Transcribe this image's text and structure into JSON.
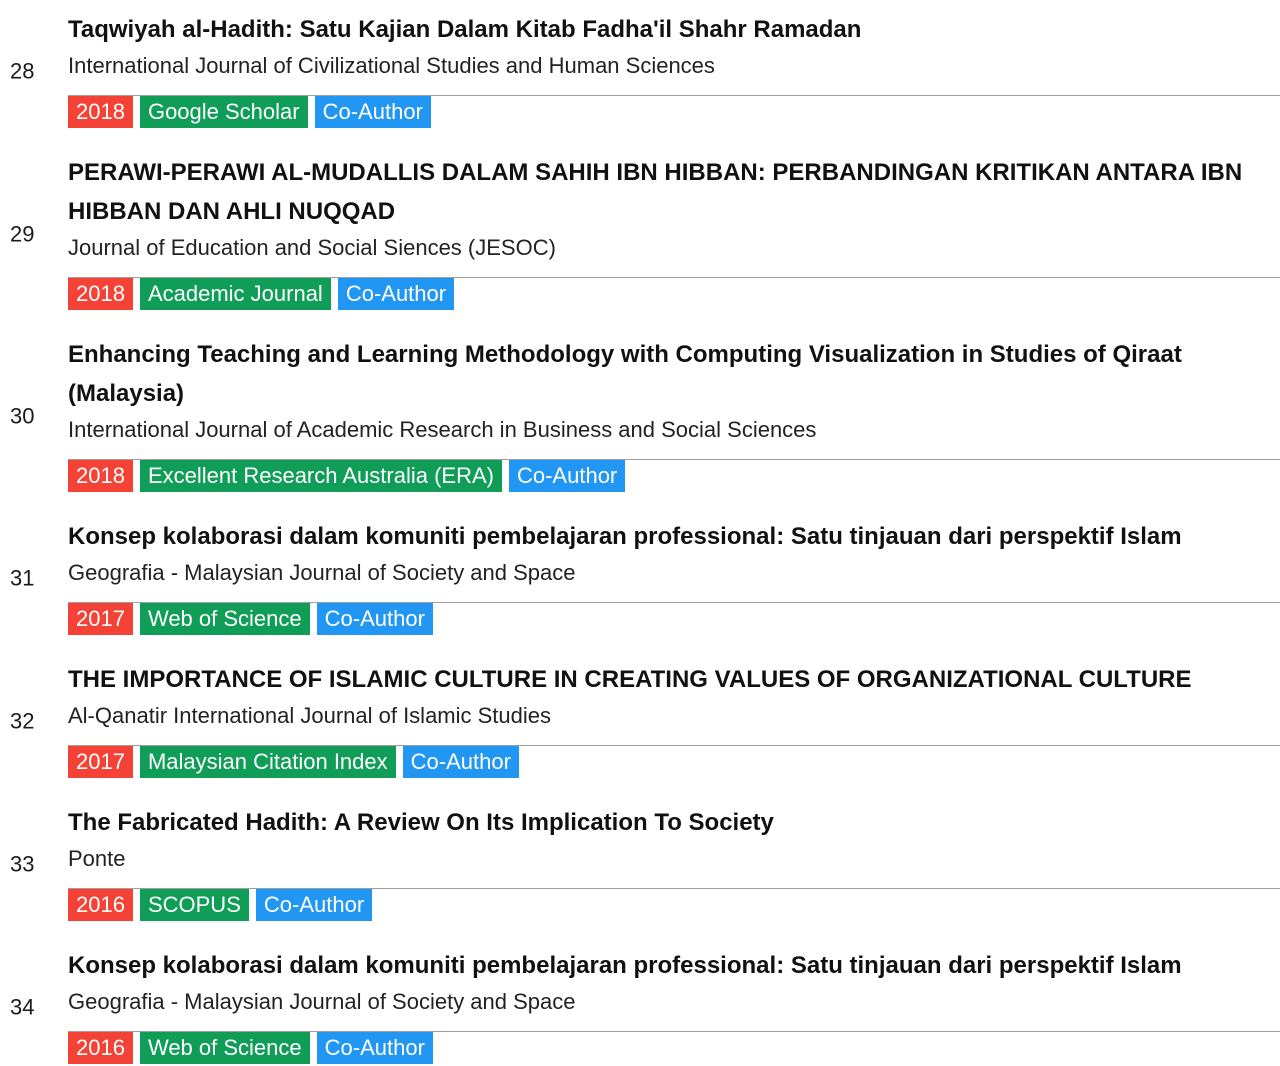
{
  "publications": [
    {
      "number": "28",
      "title": "Taqwiyah al-Hadith: Satu Kajian Dalam Kitab Fadha'il Shahr Ramadan",
      "journal": "International Journal of Civilizational Studies and Human Sciences",
      "year": "2018",
      "index": "Google Scholar",
      "role": "Co-Author"
    },
    {
      "number": "29",
      "title": "PERAWI-PERAWI AL-MUDALLIS DALAM SAHIH IBN HIBBAN: PERBANDINGAN KRITIKAN ANTARA IBN HIBBAN DAN AHLI NUQQAD",
      "journal": "Journal of Education and Social Siences (JESOC)",
      "year": "2018",
      "index": "Academic Journal",
      "role": "Co-Author"
    },
    {
      "number": "30",
      "title": "Enhancing Teaching and Learning Methodology with Computing Visualization in Studies of Qiraat (Malaysia)",
      "journal": "International Journal of Academic Research in Business and Social Sciences",
      "year": "2018",
      "index": "Excellent Research Australia (ERA)",
      "role": "Co-Author"
    },
    {
      "number": "31",
      "title": "Konsep kolaborasi dalam komuniti pembelajaran professional: Satu tinjauan dari perspektif Islam",
      "journal": "Geografia - Malaysian Journal of Society and Space",
      "year": "2017",
      "index": "Web of Science",
      "role": "Co-Author"
    },
    {
      "number": "32",
      "title": "THE IMPORTANCE OF ISLAMIC CULTURE IN CREATING VALUES OF ORGANIZATIONAL CULTURE",
      "journal": "Al-Qanatir International Journal of Islamic Studies",
      "year": "2017",
      "index": "Malaysian Citation Index",
      "role": "Co-Author"
    },
    {
      "number": "33",
      "title": "The Fabricated Hadith: A Review On Its Implication To Society",
      "journal": "Ponte",
      "year": "2016",
      "index": "SCOPUS",
      "role": "Co-Author"
    },
    {
      "number": "34",
      "title": "Konsep kolaborasi dalam komuniti pembelajaran professional: Satu tinjauan dari perspektif Islam",
      "journal": "Geografia - Malaysian Journal of Society and Space",
      "year": "2016",
      "index": "Web of Science",
      "role": "Co-Author"
    }
  ],
  "colors": {
    "year_tag": "#f44336",
    "index_tag": "#0f9d58",
    "role_tag": "#2196f3",
    "tag_text": "#ffffff",
    "divider": "#9e9e9e"
  }
}
